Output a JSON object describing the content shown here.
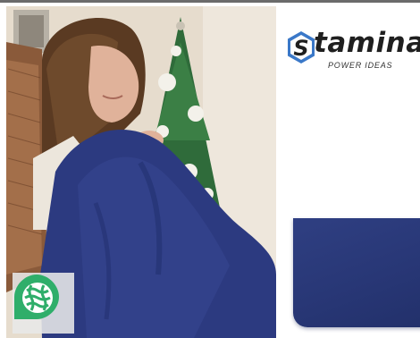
{
  "brand": {
    "logo_letter": "S",
    "name": "tamina",
    "tagline": "POWER IDEAS"
  },
  "photo": {
    "icon": "woman-with-blue-blanket-photo",
    "blanket_color": "#2c3a80"
  },
  "badge": {
    "icon": "knit-texture-badge-icon",
    "color": "#2fae6a"
  },
  "swatch": {
    "icon": "blanket-corner-swatch",
    "color": "#2a3878"
  },
  "colors": {
    "logo_blue": "#3a78c8",
    "text_dark": "#1f1f1f"
  }
}
